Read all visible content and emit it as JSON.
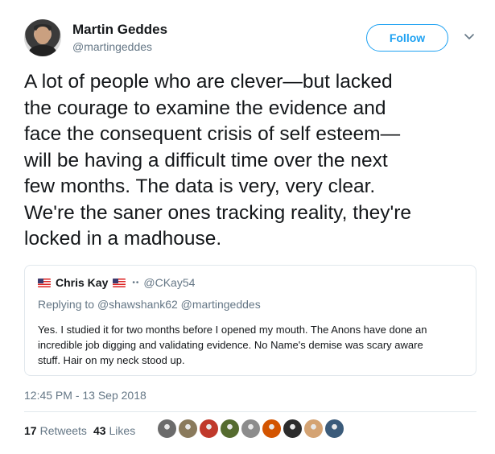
{
  "author": {
    "name": "Martin Geddes",
    "handle": "@martingeddes"
  },
  "follow_label": "Follow",
  "tweet_lines": [
    "A lot of people who are clever—but lacked",
    "the courage to examine the evidence and",
    "face the consequent crisis of self esteem—",
    "will be having a difficult time over the next",
    "few months. The data is very, very clear.",
    "We're the saner ones tracking reality, they're",
    "locked in a madhouse."
  ],
  "quoted": {
    "name": "Chris Kay",
    "dots": "••",
    "handle": "@CKay54",
    "reply_prefix": "Replying to",
    "reply_mentions": "@shawshank62 @martingeddes",
    "body_lines": [
      "Yes.  I studied it for two months before I opened my mouth.  The Anons have done an",
      "incredible job digging and validating evidence.  No Name's demise was scary aware",
      "stuff.  Hair on my neck stood up."
    ]
  },
  "timestamp": "12:45 PM - 13 Sep 2018",
  "stats": {
    "retweets_count": "17",
    "retweets_label": "Retweets",
    "likes_count": "43",
    "likes_label": "Likes"
  },
  "colors": {
    "accent": "#1da1f2",
    "secondary_text": "#657786",
    "border": "#e1e8ed"
  },
  "liker_avatars": [
    {
      "color": "#6b6b6b"
    },
    {
      "color": "#8a7a5c"
    },
    {
      "color": "#c0392b"
    },
    {
      "color": "#556b2f"
    },
    {
      "color": "#8c8c8c"
    },
    {
      "color": "#d35400"
    },
    {
      "color": "#2c2c2c"
    },
    {
      "color": "#d4a373"
    },
    {
      "color": "#3b5b7a"
    }
  ]
}
